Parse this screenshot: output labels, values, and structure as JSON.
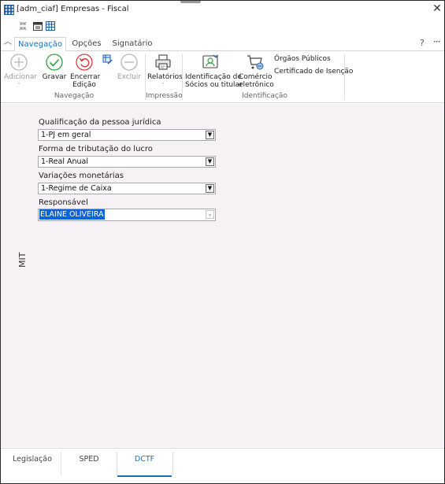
{
  "window": {
    "title": "[adm_ciaf] Empresas - Fiscal",
    "close_glyph": "✕"
  },
  "quick_access": {
    "icons": [
      "collapse-arrows-icon",
      "calendar-icon",
      "grid-table-icon"
    ]
  },
  "ribbon_tabs": [
    {
      "label": "Navegação",
      "active": true
    },
    {
      "label": "Opções",
      "active": false
    },
    {
      "label": "Signatário",
      "active": false
    }
  ],
  "ribbon_right": {
    "help": "?",
    "more": "···"
  },
  "ribbon": {
    "navegacao": {
      "group_label": "Navegação",
      "adicionar": "Adicionar",
      "adicionar_sub": "-",
      "gravar": "Gravar",
      "encerrar_line1": "Encerrar",
      "encerrar_line2": "Edição",
      "excluir": "Excluir"
    },
    "impressao": {
      "group_label": "Impressão",
      "relatorios": "Relatórios",
      "relatorios_sub": "-"
    },
    "identificacao": {
      "group_label": "Identificação",
      "socios_line1": "Identificação de",
      "socios_line2": "Sócios ou titular",
      "comercio_line1": "Comércio",
      "comercio_line2": "eletrônico",
      "orgaos": "Órgãos Públicos",
      "certificado": "Certificado de Isenção"
    }
  },
  "form": {
    "side_label": "MIT",
    "qualificacao": {
      "label": "Qualificação da pessoa jurídica",
      "value": "1-PJ em geral"
    },
    "tributacao": {
      "label": "Forma de tributação do lucro",
      "value": "1-Real Anual"
    },
    "variacoes": {
      "label": "Variações monetárias",
      "value": "1-Regime de Caixa"
    },
    "responsavel": {
      "label": "Responsável",
      "value": "ELAINE OLIVEIRA"
    }
  },
  "bottom_tabs": [
    {
      "label": "Legislação",
      "active": false
    },
    {
      "label": "SPED",
      "active": false
    },
    {
      "label": "DCTF",
      "active": true
    }
  ],
  "colors": {
    "accent": "#1a6fb5",
    "content_bg": "#f5f1f4",
    "selection": "#0a64d8",
    "ok_green": "#2e9e3e",
    "cancel_red": "#d43b3b"
  }
}
